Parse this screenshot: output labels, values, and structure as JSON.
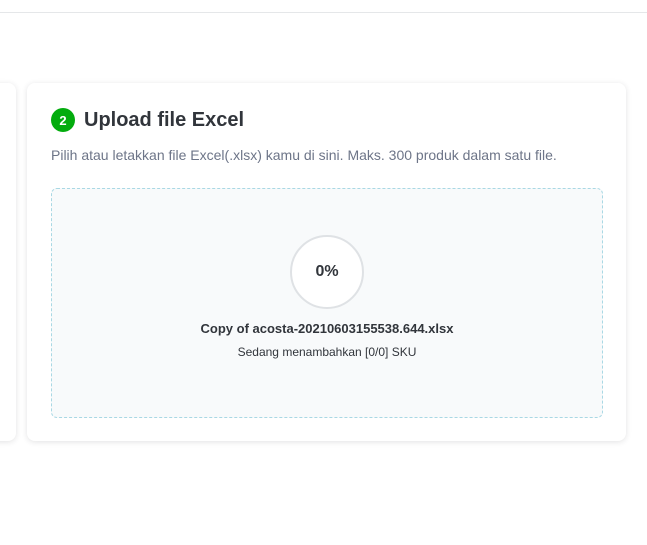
{
  "upload_card": {
    "step_number": "2",
    "title": "Upload file Excel",
    "description": "Pilih atau letakkan file Excel(.xlsx) kamu di sini. Maks. 300 produk dalam satu file.",
    "progress": {
      "percent_label": "0%",
      "value": 0
    },
    "file_name": "Copy of acosta-20210603155538.644.xlsx",
    "status": "Sedang menambahkan [0/0] SKU"
  },
  "colors": {
    "accent": "#03ac0e",
    "dropzone_border": "#a9d8e4",
    "dropzone_bg": "#f8fafb",
    "text_primary": "#31353b",
    "text_secondary": "#6d7588"
  }
}
